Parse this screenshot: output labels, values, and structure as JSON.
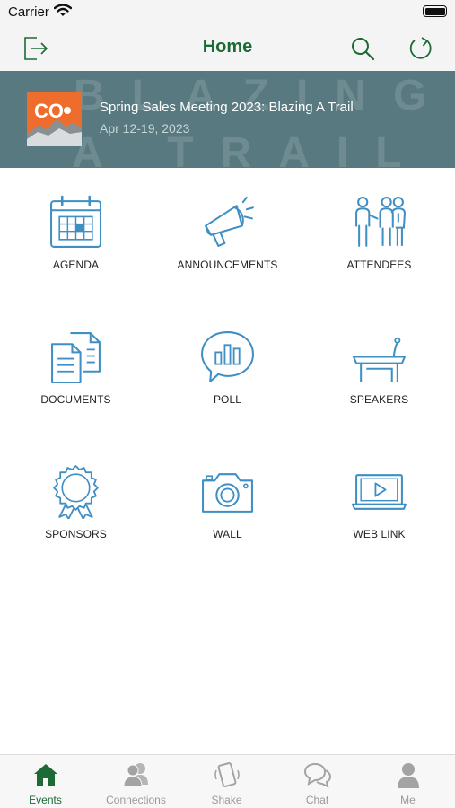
{
  "status": {
    "carrier": "Carrier"
  },
  "nav": {
    "title": "Home"
  },
  "banner": {
    "watermark_line1": "BLAZING",
    "watermark_line2": "A TRAIL",
    "logo_text": "CO",
    "event_title": "Spring Sales Meeting 2023: Blazing A Trail",
    "event_dates": "Apr 12-19, 2023"
  },
  "grid": [
    {
      "label": "AGENDA",
      "icon": "calendar-icon"
    },
    {
      "label": "ANNOUNCEMENTS",
      "icon": "megaphone-icon"
    },
    {
      "label": "ATTENDEES",
      "icon": "people-icon"
    },
    {
      "label": "DOCUMENTS",
      "icon": "documents-icon"
    },
    {
      "label": "POLL",
      "icon": "poll-icon"
    },
    {
      "label": "SPEAKERS",
      "icon": "podium-icon"
    },
    {
      "label": "SPONSORS",
      "icon": "rosette-icon"
    },
    {
      "label": "WALL",
      "icon": "camera-icon"
    },
    {
      "label": "WEB LINK",
      "icon": "video-laptop-icon"
    }
  ],
  "tabs": [
    {
      "label": "Events",
      "icon": "house-icon",
      "active": true
    },
    {
      "label": "Connections",
      "icon": "connections-icon"
    },
    {
      "label": "Shake",
      "icon": "shake-phone-icon"
    },
    {
      "label": "Chat",
      "icon": "chat-bubbles-icon"
    },
    {
      "label": "Me",
      "icon": "person-icon"
    }
  ],
  "colors": {
    "accent": "#1c6b36",
    "icon_blue": "#3f8fc4",
    "banner_bg": "#587980",
    "logo_orange": "#ef6d2c"
  }
}
